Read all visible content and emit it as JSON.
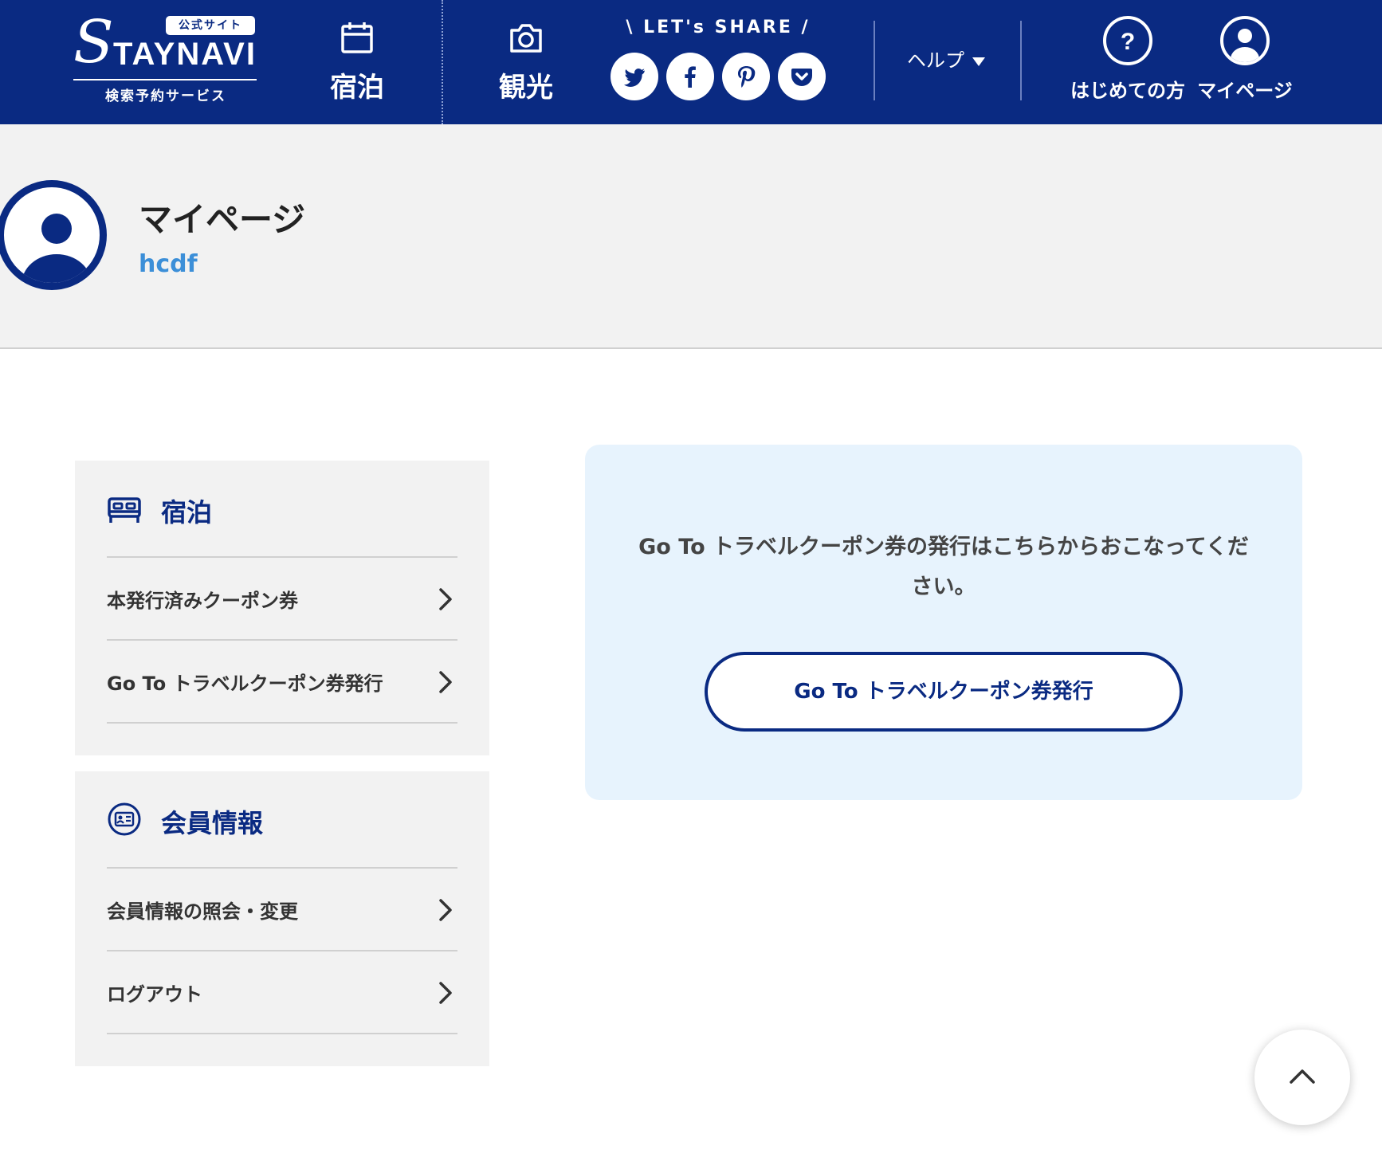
{
  "header": {
    "logo": {
      "badge": "公式サイト",
      "word": "TAYNAVI",
      "subtitle": "検索予約サービス"
    },
    "nav": {
      "stay_label": "宿泊",
      "sightseeing_label": "観光"
    },
    "share": {
      "title": "\\ LET's SHARE /",
      "buttons": [
        "twitter-icon",
        "facebook-icon",
        "pinterest-icon",
        "pocket-icon"
      ]
    },
    "help_label": "ヘルプ",
    "beginner_label": "はじめての方",
    "mypage_label": "マイページ"
  },
  "profile": {
    "title": "マイページ",
    "username": "hcdf"
  },
  "sidebar": {
    "stay": {
      "heading": "宿泊",
      "links": [
        {
          "label": "本発行済みクーポン券"
        },
        {
          "label": "Go To トラベルクーポン券発行"
        }
      ]
    },
    "member": {
      "heading": "会員情報",
      "links": [
        {
          "label": "会員情報の照会・変更"
        },
        {
          "label": "ログアウト"
        }
      ]
    }
  },
  "panel": {
    "message_line1": "Go To トラベルクーポン券の発行はこちらからおこなってくだ",
    "message_line2": "さい。",
    "button_label": "Go To トラベルクーポン券発行"
  },
  "colors": {
    "brand_navy": "#0a2a82",
    "username_blue": "#3c8fd8",
    "panel_bg": "#e7f3fd",
    "band_gray": "#f2f2f2"
  }
}
